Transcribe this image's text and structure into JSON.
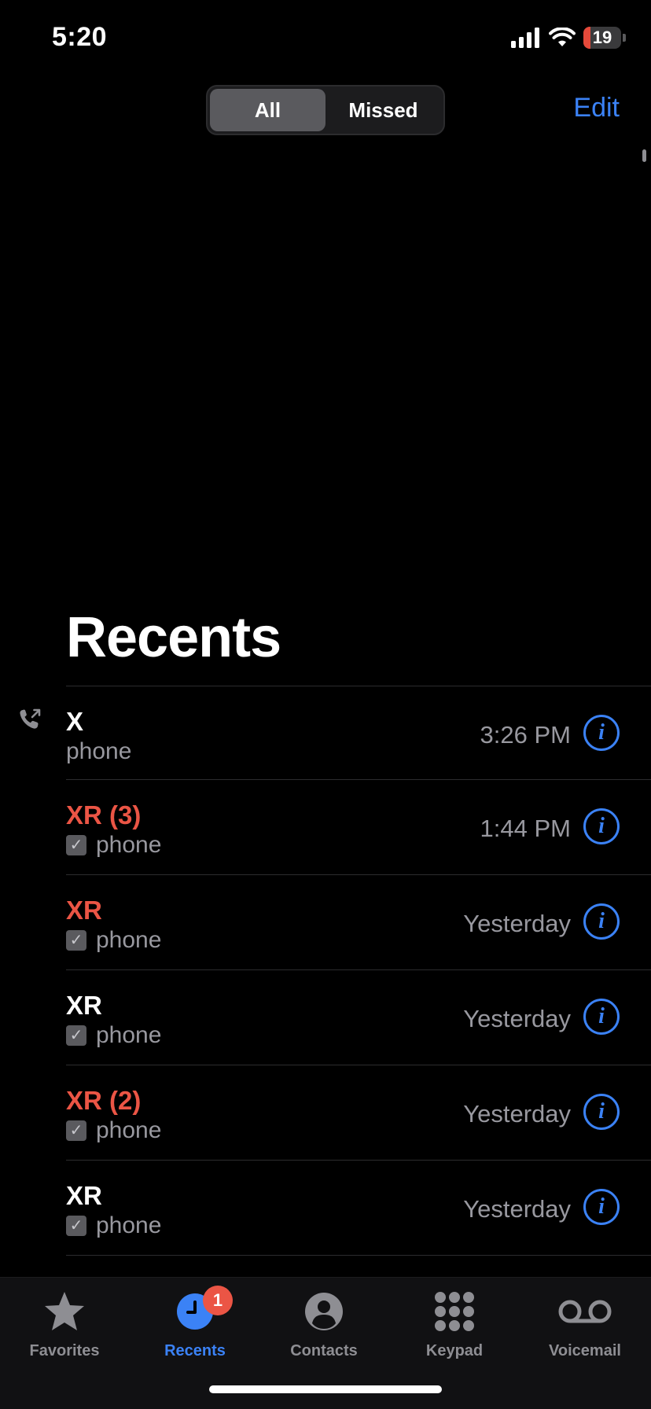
{
  "status_bar": {
    "time": "5:20",
    "battery": "19",
    "battery_level": 0.19
  },
  "segments": {
    "all": "All",
    "missed": "Missed",
    "selected": "All"
  },
  "edit_label": "Edit",
  "title": "Recents",
  "calls": [
    {
      "name": "X",
      "type": "phone",
      "time": "3:26 PM",
      "missed": false,
      "outgoing": true,
      "checkbox": false
    },
    {
      "name": "XR (3)",
      "type": "phone",
      "time": "1:44 PM",
      "missed": true,
      "outgoing": false,
      "checkbox": true
    },
    {
      "name": "XR",
      "type": "phone",
      "time": "Yesterday",
      "missed": true,
      "outgoing": false,
      "checkbox": true
    },
    {
      "name": "XR",
      "type": "phone",
      "time": "Yesterday",
      "missed": false,
      "outgoing": false,
      "checkbox": true
    },
    {
      "name": "XR (2)",
      "type": "phone",
      "time": "Yesterday",
      "missed": true,
      "outgoing": false,
      "checkbox": true
    },
    {
      "name": "XR",
      "type": "phone",
      "time": "Yesterday",
      "missed": false,
      "outgoing": false,
      "checkbox": true
    }
  ],
  "tab_bar": {
    "favorites": "Favorites",
    "recents": "Recents",
    "contacts": "Contacts",
    "keypad": "Keypad",
    "voicemail": "Voicemail",
    "recents_badge": "1",
    "active": "Recents"
  },
  "colors": {
    "accent": "#3b82f6",
    "missed": "#eb5545",
    "secondary": "#98989f"
  },
  "icons": {
    "info": "info-circle-icon",
    "outgoing": "outgoing-call-icon",
    "favorites": "star-icon",
    "recents": "clock-icon",
    "contacts": "person-circle-icon",
    "keypad": "keypad-grid-icon",
    "voicemail": "voicemail-icon"
  }
}
